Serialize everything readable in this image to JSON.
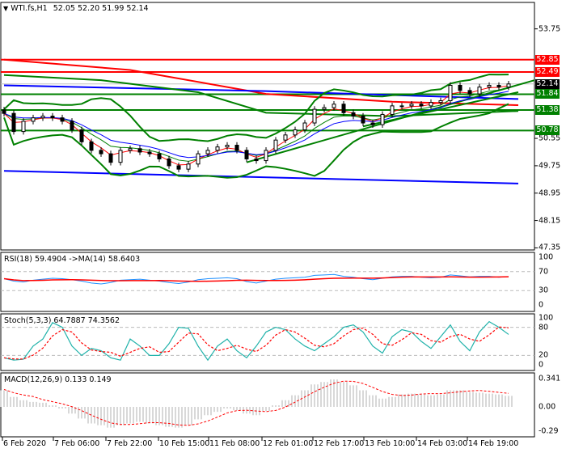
{
  "header": {
    "symbol": "WTI.fs,H1",
    "ohlc": "52.05 52.20 51.99 52.14"
  },
  "colors": {
    "bull": "#ffffff",
    "bear": "#000000",
    "red": "#ff0000",
    "blue": "#0000ff",
    "green": "#008000",
    "teal": "#20b2aa",
    "rsi": "#1e90ff",
    "grey": "#c0c0c0"
  },
  "chart_data": [
    {
      "type": "candlestick",
      "title": "WTI.fs,H1",
      "ylim": [
        47.35,
        54.2
      ],
      "y_ticks": [
        "53.75",
        "50.55",
        "49.75",
        "48.95",
        "48.15",
        "47.35"
      ],
      "x_tick_labels": [
        "6 Feb 2020",
        "7 Feb 06:00",
        "7 Feb 22:00",
        "10 Feb 15:00",
        "11 Feb 08:00",
        "12 Feb 01:00",
        "12 Feb 17:00",
        "13 Feb 10:00",
        "14 Feb 03:00",
        "14 Feb 19:00"
      ],
      "close": [
        51.28,
        50.75,
        51.05,
        51.15,
        51.2,
        51.15,
        51.05,
        50.8,
        50.45,
        50.2,
        50.1,
        49.85,
        50.2,
        50.25,
        50.15,
        50.1,
        49.95,
        49.75,
        49.65,
        49.8,
        50.1,
        50.2,
        50.3,
        50.35,
        50.2,
        49.95,
        49.9,
        50.2,
        50.5,
        50.65,
        50.8,
        51.0,
        51.4,
        51.45,
        51.55,
        51.3,
        51.2,
        51.0,
        50.95,
        51.25,
        51.5,
        51.5,
        51.55,
        51.5,
        51.6,
        51.65,
        52.1,
        51.95,
        51.85,
        52.05,
        52.1,
        52.05,
        52.14
      ],
      "price_levels": [
        {
          "label": "52.85",
          "value": 52.85,
          "color": "#ff0000"
        },
        {
          "label": "52.49",
          "value": 52.49,
          "color": "#ff0000"
        },
        {
          "label": "52.14",
          "value": 52.14,
          "color": "#000000"
        },
        {
          "label": "51.84",
          "value": 51.84,
          "color": "#008000"
        },
        {
          "label": "51.38",
          "value": 51.38,
          "color": "#008000"
        },
        {
          "label": "50.78",
          "value": 50.78,
          "color": "#008000"
        }
      ],
      "overlay_lines": [
        {
          "name": "slow-red-ma",
          "color": "#ff0000",
          "points": [
            [
              0,
              52.85
            ],
            [
              13,
              52.55
            ],
            [
              27,
              51.85
            ],
            [
              40,
              51.62
            ],
            [
              53,
              51.52
            ]
          ]
        },
        {
          "name": "slow-blue-ma",
          "color": "#0000ff",
          "points": [
            [
              0,
              52.1
            ],
            [
              27,
              51.93
            ],
            [
              53,
              51.7
            ]
          ]
        },
        {
          "name": "slow-green-band",
          "color": "#008000",
          "points": [
            [
              0,
              52.4
            ],
            [
              10,
              52.25
            ],
            [
              20,
              51.9
            ],
            [
              27,
              51.3
            ],
            [
              40,
              51.2
            ],
            [
              53,
              51.35
            ]
          ]
        },
        {
          "name": "lower-blue-trendline",
          "color": "#0000ff",
          "points": [
            [
              0,
              49.6
            ],
            [
              53,
              49.23
            ]
          ]
        },
        {
          "name": "green-trendline-1",
          "color": "#008000",
          "points": [
            [
              25,
              49.85
            ],
            [
              55,
              52.25
            ]
          ]
        },
        {
          "name": "green-trendline-2",
          "color": "#008000",
          "points": [
            [
              37,
              50.9
            ],
            [
              53,
              51.9
            ]
          ]
        }
      ]
    },
    {
      "type": "line",
      "title": "RSI(18) 59.4904  ->MA(14) 58.6403",
      "ylim": [
        0,
        100
      ],
      "y_ticks": [
        "100",
        "70",
        "30",
        "0"
      ],
      "levels": [
        70,
        30
      ],
      "rsi": [
        55,
        50,
        48,
        52,
        54,
        56,
        55,
        53,
        50,
        46,
        44,
        47,
        52,
        53,
        54,
        52,
        50,
        47,
        45,
        48,
        53,
        55,
        56,
        57,
        55,
        49,
        46,
        50,
        54,
        56,
        57,
        58,
        62,
        63,
        64,
        60,
        58,
        55,
        53,
        56,
        59,
        60,
        60,
        58,
        57,
        58,
        63,
        61,
        59,
        60,
        60,
        58,
        59.49
      ]
    },
    {
      "type": "line",
      "title": "Stoch(5,3,3) 64.7887 74.3562",
      "ylim": [
        0,
        100
      ],
      "y_ticks": [
        "100",
        "80",
        "20",
        "0"
      ],
      "levels": [
        80,
        20
      ],
      "k": [
        15,
        10,
        12,
        40,
        55,
        90,
        80,
        40,
        20,
        35,
        30,
        15,
        10,
        55,
        40,
        20,
        20,
        45,
        80,
        78,
        40,
        10,
        40,
        55,
        30,
        15,
        40,
        70,
        80,
        75,
        55,
        40,
        30,
        45,
        60,
        80,
        85,
        70,
        40,
        25,
        60,
        75,
        70,
        50,
        35,
        60,
        85,
        50,
        30,
        70,
        92,
        80,
        64.79
      ]
    },
    {
      "type": "bar",
      "title": "MACD(12,26,9) 0.133 0.149",
      "ylim": [
        -0.29,
        0.341
      ],
      "y_ticks": [
        "0.341",
        "0.00",
        "-0.29"
      ],
      "histogram": [
        0.2,
        0.12,
        0.08,
        0.06,
        0.05,
        0.02,
        -0.02,
        -0.08,
        -0.14,
        -0.2,
        -0.22,
        -0.25,
        -0.22,
        -0.2,
        -0.18,
        -0.2,
        -0.22,
        -0.24,
        -0.25,
        -0.22,
        -0.15,
        -0.1,
        -0.06,
        -0.02,
        -0.04,
        -0.08,
        -0.1,
        -0.05,
        0.02,
        0.08,
        0.14,
        0.2,
        0.27,
        0.3,
        0.33,
        0.3,
        0.26,
        0.2,
        0.14,
        0.1,
        0.12,
        0.15,
        0.16,
        0.15,
        0.14,
        0.15,
        0.2,
        0.2,
        0.18,
        0.17,
        0.16,
        0.15,
        0.133
      ]
    }
  ]
}
